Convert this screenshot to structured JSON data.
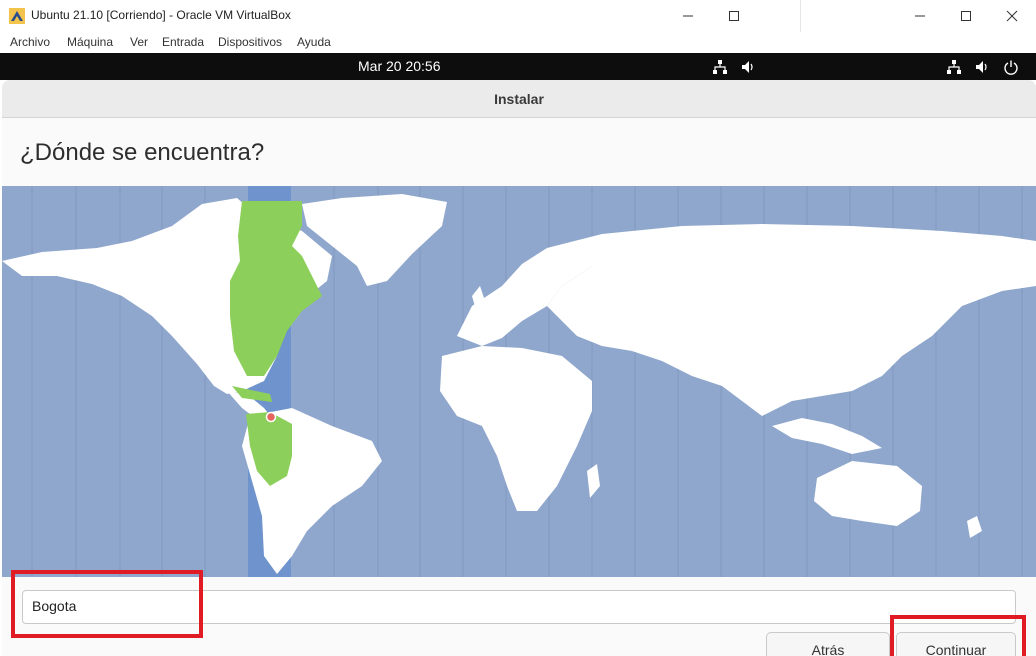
{
  "vm_window": {
    "title": "Ubuntu 21.10 [Corriendo] - Oracle VM VirtualBox",
    "menu": [
      "Archivo",
      "Máquina",
      "Ver",
      "Entrada",
      "Dispositivos",
      "Ayuda"
    ],
    "controls": [
      "minimize-icon",
      "maximize-icon",
      "close-icon"
    ]
  },
  "ubuntu_panel": {
    "clock": "Mar 20  20:56",
    "icons": [
      "network-icon",
      "volume-icon",
      "network-icon",
      "volume-icon",
      "power-icon"
    ]
  },
  "installer": {
    "window_title": "Instalar",
    "heading": "¿Dónde se encuentra?",
    "timezone_value": "Bogota",
    "back_label": "Atrás",
    "continue_label": "Continuar"
  },
  "colors": {
    "map_ocean": "#8fa7cc",
    "selected_zone": "#6f93cc",
    "selected_region": "#8ccf5a",
    "highlight": "#e01b24"
  }
}
